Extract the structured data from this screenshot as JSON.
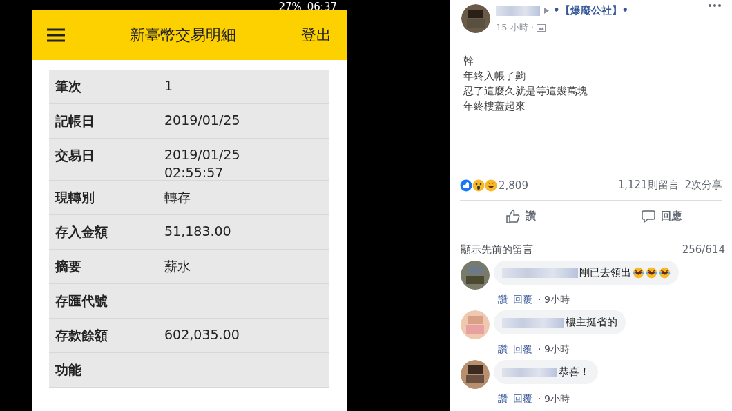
{
  "phone": {
    "status_bar": {
      "battery": "27%",
      "time": "06:37"
    },
    "header": {
      "title": "新臺幣交易明細",
      "logout": "登出"
    },
    "rows": [
      {
        "label": "筆次",
        "lines": [
          "1"
        ]
      },
      {
        "label": "記帳日",
        "lines": [
          "2019/01/25"
        ]
      },
      {
        "label": "交易日",
        "lines": [
          "2019/01/25",
          "02:55:57"
        ]
      },
      {
        "label": "現轉別",
        "lines": [
          "轉存"
        ]
      },
      {
        "label": "存入金額",
        "lines": [
          "51,183.00"
        ]
      },
      {
        "label": "摘要",
        "lines": [
          "薪水"
        ]
      },
      {
        "label": "存匯代號",
        "lines": []
      },
      {
        "label": "存款餘額",
        "lines": [
          "602,035.00"
        ]
      },
      {
        "label": "功能",
        "lines": []
      }
    ]
  },
  "post": {
    "group": "•【爆廢公社】•",
    "time": "15 小時 ·",
    "text": [
      "幹",
      "年終入帳了齁",
      "忍了這麼久就是等這幾萬塊",
      "年終樓蓋起來"
    ],
    "reactions": "2,809",
    "comments_count": "1,121則留言",
    "shares": "2次分享",
    "actions": [
      {
        "kind": "like",
        "label": "讚"
      },
      {
        "kind": "comment",
        "label": "回應"
      }
    ],
    "show_previous": "顯示先前的留言",
    "comment_range": "256/614",
    "comments": [
      {
        "text": "剛已去領出",
        "laughing_emojis": true,
        "like": "讚",
        "reply": "回覆",
        "time": "· 9小時"
      },
      {
        "text": "樓主挺省的",
        "laughing_emojis": false,
        "like": "讚",
        "reply": "回覆",
        "time": "· 9小時"
      },
      {
        "text": "恭喜！",
        "laughing_emojis": false,
        "like": "讚",
        "reply": "回覆",
        "time": "· 9小時"
      }
    ]
  }
}
